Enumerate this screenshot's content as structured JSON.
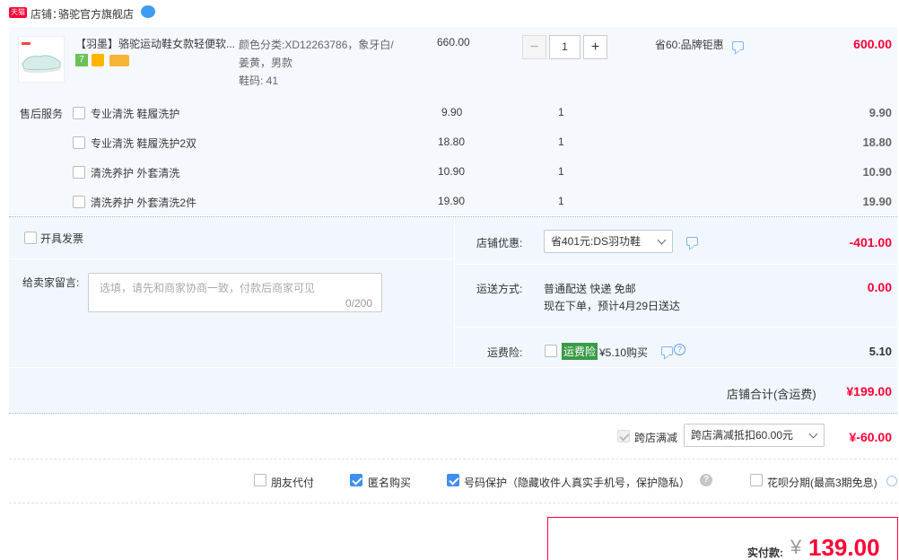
{
  "shop": {
    "badge": "天猫",
    "label": "店铺：",
    "name": "骆驼官方旗舰店"
  },
  "product": {
    "title": "【羽墨】骆驼运动鞋女款轻便软...",
    "color_label": "颜色分类:",
    "color_value": "XD12263786，象牙白/姜黄，男款",
    "size_label": "鞋码:",
    "size_value": "41",
    "price": "660.00",
    "quantity": "1",
    "minus": "−",
    "plus": "+",
    "discount_text": "省60:品牌钜惠",
    "subtotal": "600.00"
  },
  "after_sales": {
    "label": "售后服务",
    "items": [
      {
        "name": "专业清洗 鞋履洗护",
        "price": "9.90",
        "qty": "1",
        "total": "9.90"
      },
      {
        "name": "专业清洗 鞋履洗护2双",
        "price": "18.80",
        "qty": "1",
        "total": "18.80"
      },
      {
        "name": "清洗养护 外套清洗",
        "price": "10.90",
        "qty": "1",
        "total": "10.90"
      },
      {
        "name": "清洗养护 外套清洗2件",
        "price": "19.90",
        "qty": "1",
        "total": "19.90"
      }
    ]
  },
  "invoice": {
    "label": "开具发票"
  },
  "message": {
    "label": "给卖家留言:",
    "placeholder": "选填，请先和商家协商一致，付款后商家可见",
    "counter": "0/200"
  },
  "shop_discount": {
    "label": "店铺优惠:",
    "selected": "省401元:DS羽功鞋",
    "amount": "-401.00"
  },
  "shipping": {
    "label": "运送方式:",
    "method": "普通配送 快递 免邮",
    "note": "现在下单，预计4月29日送达",
    "amount": "0.00"
  },
  "insurance": {
    "label": "运费险:",
    "tag": "运费险",
    "price_text": "¥5.10购买",
    "amount": "5.10"
  },
  "shop_total": {
    "label": "店铺合计(含运费)",
    "amount": "¥199.00"
  },
  "cross_store": {
    "label": "跨店满减",
    "selected": "跨店满减抵扣60.00元",
    "amount": "¥-60.00"
  },
  "options": {
    "friend_pay": "朋友代付",
    "anonymous": "匿名购买",
    "number_protect": "号码保护（隐藏收件人真实手机号，保护隐私）",
    "huabei": "花呗分期(最高3期免息)"
  },
  "payment": {
    "label": "实付款:",
    "currency": "¥",
    "amount": "139.00"
  },
  "colors": {
    "accent_red": "#ff0036",
    "light_blue_bg": "#f2f7ff",
    "checkbox_blue": "#3f8ef0"
  }
}
